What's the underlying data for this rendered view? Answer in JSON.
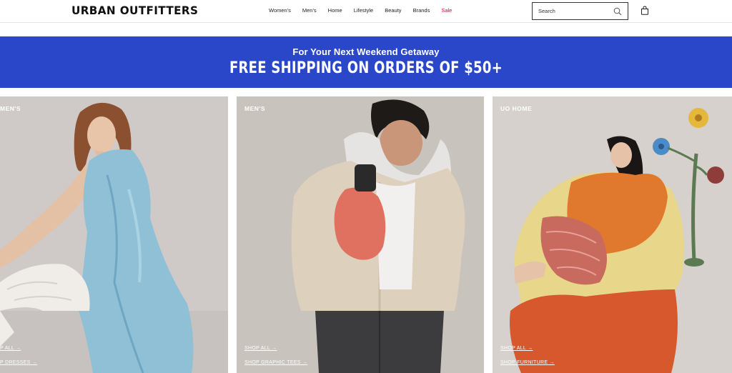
{
  "header": {
    "logo": "URBAN OUTFITTERS",
    "nav": [
      "Women's",
      "Men's",
      "Home",
      "Lifestyle",
      "Beauty",
      "Brands",
      "Sale"
    ],
    "search_placeholder": "Search"
  },
  "promo": {
    "subtitle": "For Your Next Weekend Getaway",
    "title": "FREE SHIPPING ON ORDERS OF $50+"
  },
  "tiles": {
    "women": {
      "title": "MEN'S",
      "link1": "P ALL →",
      "link2": "P DRESSES →"
    },
    "men": {
      "title": "MEN'S",
      "link1": "SHOP ALL →",
      "link2": "SHOP GRAPHIC TEES →"
    },
    "home": {
      "title": "UO HOME",
      "link1": "SHOP ALL →",
      "link2": "SHOP FURNITURE →"
    }
  },
  "colors": {
    "promo_bg": "#2a46c9",
    "sale": "#c8102e"
  }
}
